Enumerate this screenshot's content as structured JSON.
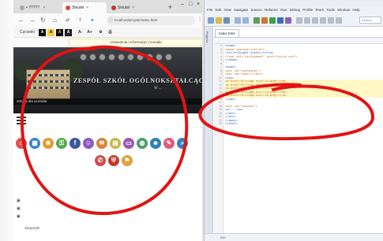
{
  "browser": {
    "tabs": [
      {
        "label": "• ????? ",
        "favicon_color": "#a7a7a7"
      },
      {
        "label": "Sleutel",
        "favicon_color": "#d04a3a"
      },
      {
        "label": "Sleutel",
        "favicon_color": "#c0392b"
      }
    ],
    "url": "localhost/projekt/index.html",
    "bookmarks_label": "Czcionki",
    "a11y_buttons": [
      "A",
      "A",
      "A",
      "A"
    ],
    "a11y_colors": [
      "#000000",
      "#f4d03f",
      "#000000",
      "#1a1a1a"
    ],
    "notice_text": "Ustawienia | Informacje | Kontakt"
  },
  "page": {
    "school_title": "ZESPÓŁ SZKÓŁ OGÓLNOKSZTAŁCĄCYCH",
    "school_subtitle": "W ...",
    "motto": "Szkoła dla uczniów",
    "icon_colors": [
      "#e24f4f",
      "#3a83c8",
      "#e99a2b",
      "#5aa84d",
      "#8c5bc1",
      "#3b5998",
      "#d9823a",
      "#c8b54a",
      "#9b59b6",
      "#2f7fb8",
      "#4a9e6f",
      "#e25a7b",
      "#d24a4a",
      "#2c82c9"
    ],
    "icon_names": [
      "home-icon",
      "calendar-icon",
      "gallery-icon",
      "lock-icon",
      "facebook-icon",
      "person-icon",
      "mail-icon",
      "book-icon",
      "globe-icon",
      "search-icon",
      "phone-icon",
      "shield-icon",
      "people-icon"
    ],
    "footer_text": "Statystyki"
  },
  "ide": {
    "menu": "File  Edit  View  Navigate  Source  Refactor  Run  Debug  Profile  Team  Tools  Window  Help",
    "file_tab": "index.html",
    "search_placeholder": "Search",
    "projects_label": "Projects",
    "status": "INS",
    "code_lines": [
      "  <head>",
      "    <meta charset=\"utf-8\">",
      "    <title>Zespół Szkół</title>",
      "    <link rel=\"stylesheet\" href=\"style.css\">",
      "  </head>",
      "",
      "  <body>",
      "    <div id=\"container\">",
      "      <div id=\"logo\"></div>",
      "      <nav>",
      "        <a href=\"#\"><img src=\"i1.png\"></a>",
      "        <a href=\"#\"><img src=\"i2.png\"></a>",
      "        <a href=\"#\"><img src=\"i3.png\"></a>",
      "        <a href=\"#\"><img src=\"i4.png\"></a>",
      "        <a href=\"#\"><img src=\"i5.png\"></a>",
      "      </nav>",
      "",
      "      <div id=\"content\">",
      "        <p>...</p>",
      "      </div>",
      "    </div>",
      "  </body>",
      "</html>"
    ]
  }
}
